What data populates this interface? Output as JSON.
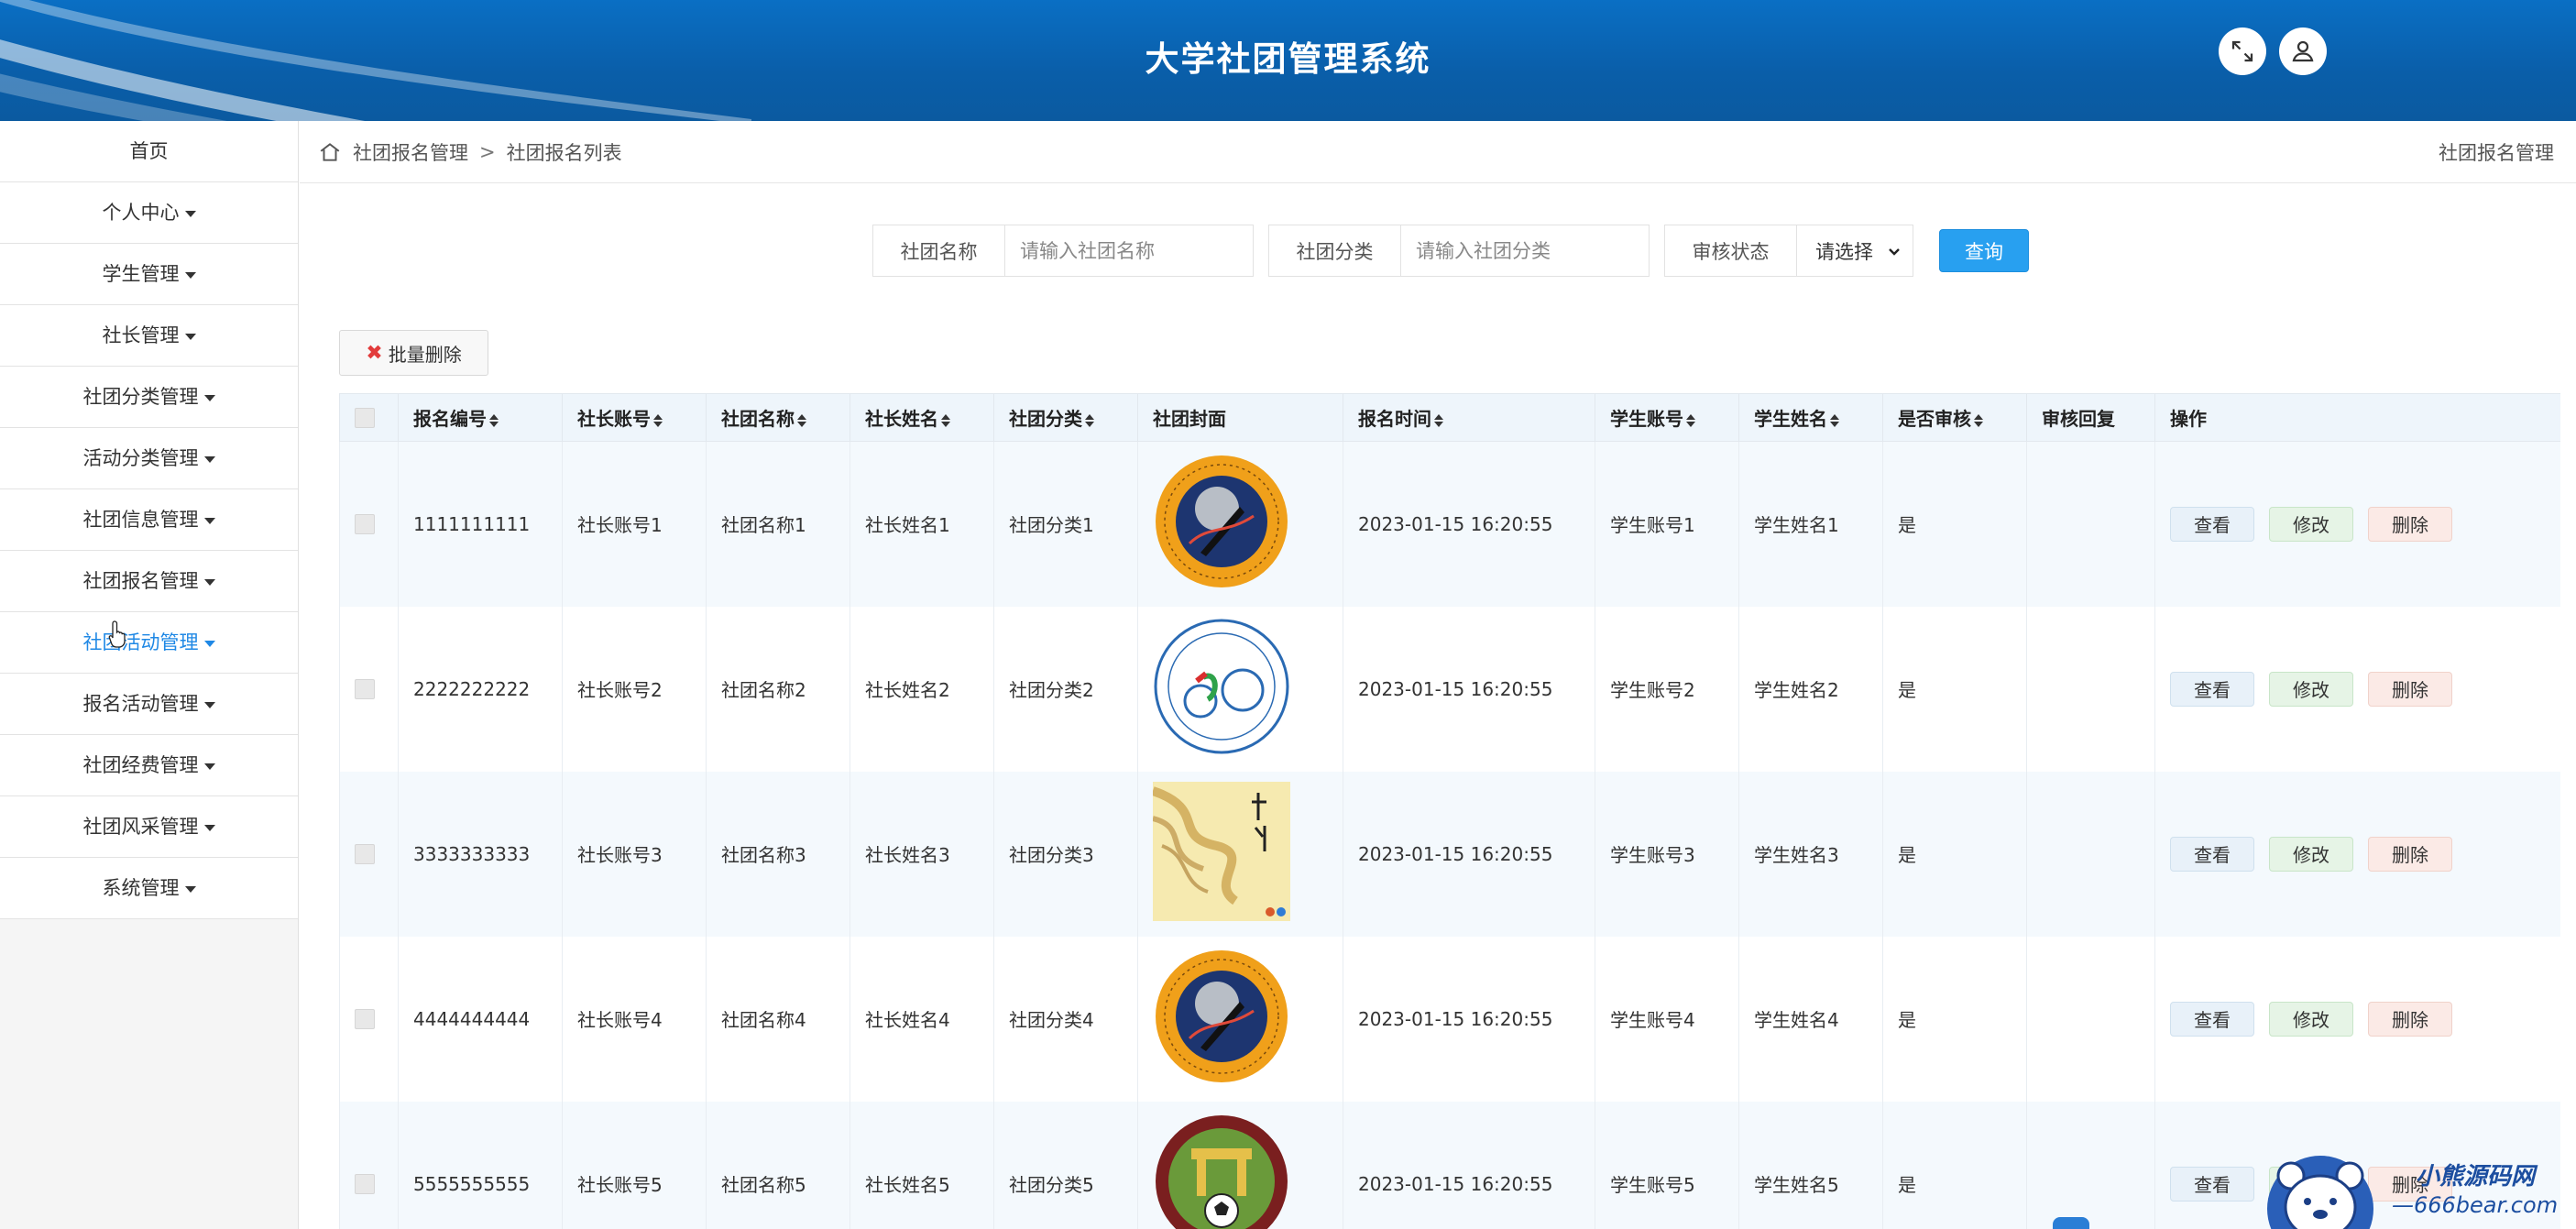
{
  "header": {
    "title": "大学社团管理系统",
    "icons": [
      "fullscreen-icon",
      "user-icon"
    ]
  },
  "sidebar": {
    "items": [
      {
        "label": "首页",
        "caret": false
      },
      {
        "label": "个人中心",
        "caret": true
      },
      {
        "label": "学生管理",
        "caret": true
      },
      {
        "label": "社长管理",
        "caret": true
      },
      {
        "label": "社团分类管理",
        "caret": true
      },
      {
        "label": "活动分类管理",
        "caret": true
      },
      {
        "label": "社团信息管理",
        "caret": true
      },
      {
        "label": "社团报名管理",
        "caret": true
      },
      {
        "label": "社团活动管理",
        "caret": true,
        "active": true
      },
      {
        "label": "报名活动管理",
        "caret": true
      },
      {
        "label": "社团经费管理",
        "caret": true
      },
      {
        "label": "社团风采管理",
        "caret": true
      },
      {
        "label": "系统管理",
        "caret": true
      }
    ]
  },
  "breadcrumb": {
    "level1": "社团报名管理",
    "separator": ">",
    "level2": "社团报名列表",
    "right_title": "社团报名管理"
  },
  "search": {
    "name_label": "社团名称",
    "name_placeholder": "请输入社团名称",
    "category_label": "社团分类",
    "category_placeholder": "请输入社团分类",
    "status_label": "审核状态",
    "status_value": "请选择",
    "query_button": "查询"
  },
  "batch_delete_label": "批量删除",
  "table": {
    "headers": [
      "报名编号",
      "社长账号",
      "社团名称",
      "社长姓名",
      "社团分类",
      "社团封面",
      "报名时间",
      "学生账号",
      "学生姓名",
      "是否审核",
      "审核回复",
      "操作"
    ],
    "rows": [
      {
        "id": "1111111111",
        "leader_account": "社长账号1",
        "club_name": "社团名称1",
        "leader_name": "社长姓名1",
        "category": "社团分类1",
        "cover": "astronomy-society-logo",
        "time": "2023-01-15 16:20:55",
        "student_account": "学生账号1",
        "student_name": "学生姓名1",
        "reviewed": "是",
        "reply": ""
      },
      {
        "id": "2222222222",
        "leader_account": "社长账号2",
        "club_name": "社团名称2",
        "leader_name": "社长姓名2",
        "category": "社团分类2",
        "cover": "cycling-society-logo",
        "time": "2023-01-15 16:20:55",
        "student_account": "学生账号2",
        "student_name": "学生姓名2",
        "reviewed": "是",
        "reply": ""
      },
      {
        "id": "3333333333",
        "leader_account": "社长账号3",
        "club_name": "社团名称3",
        "leader_name": "社长姓名3",
        "category": "社团分类3",
        "cover": "cultural-festival-poster",
        "time": "2023-01-15 16:20:55",
        "student_account": "学生账号3",
        "student_name": "学生姓名3",
        "reviewed": "是",
        "reply": ""
      },
      {
        "id": "4444444444",
        "leader_account": "社长账号4",
        "club_name": "社团名称4",
        "leader_name": "社长姓名4",
        "category": "社团分类4",
        "cover": "astronomy-society-logo",
        "time": "2023-01-15 16:20:55",
        "student_account": "学生账号4",
        "student_name": "学生姓名4",
        "reviewed": "是",
        "reply": ""
      },
      {
        "id": "5555555555",
        "leader_account": "社长账号5",
        "club_name": "社团名称5",
        "leader_name": "社长姓名5",
        "category": "社团分类5",
        "cover": "football-society-logo",
        "time": "2023-01-15 16:20:55",
        "student_account": "学生账号5",
        "student_name": "学生姓名5",
        "reviewed": "是",
        "reply": ""
      }
    ],
    "actions": {
      "view": "查看",
      "edit": "修改",
      "delete": "删除"
    }
  },
  "watermark": {
    "line1": "小熊源码网",
    "line2": "—666bear.com—"
  },
  "colors": {
    "header_bg": "#0a62b0",
    "accent": "#28a0f0",
    "active_nav": "#1f88e5"
  }
}
